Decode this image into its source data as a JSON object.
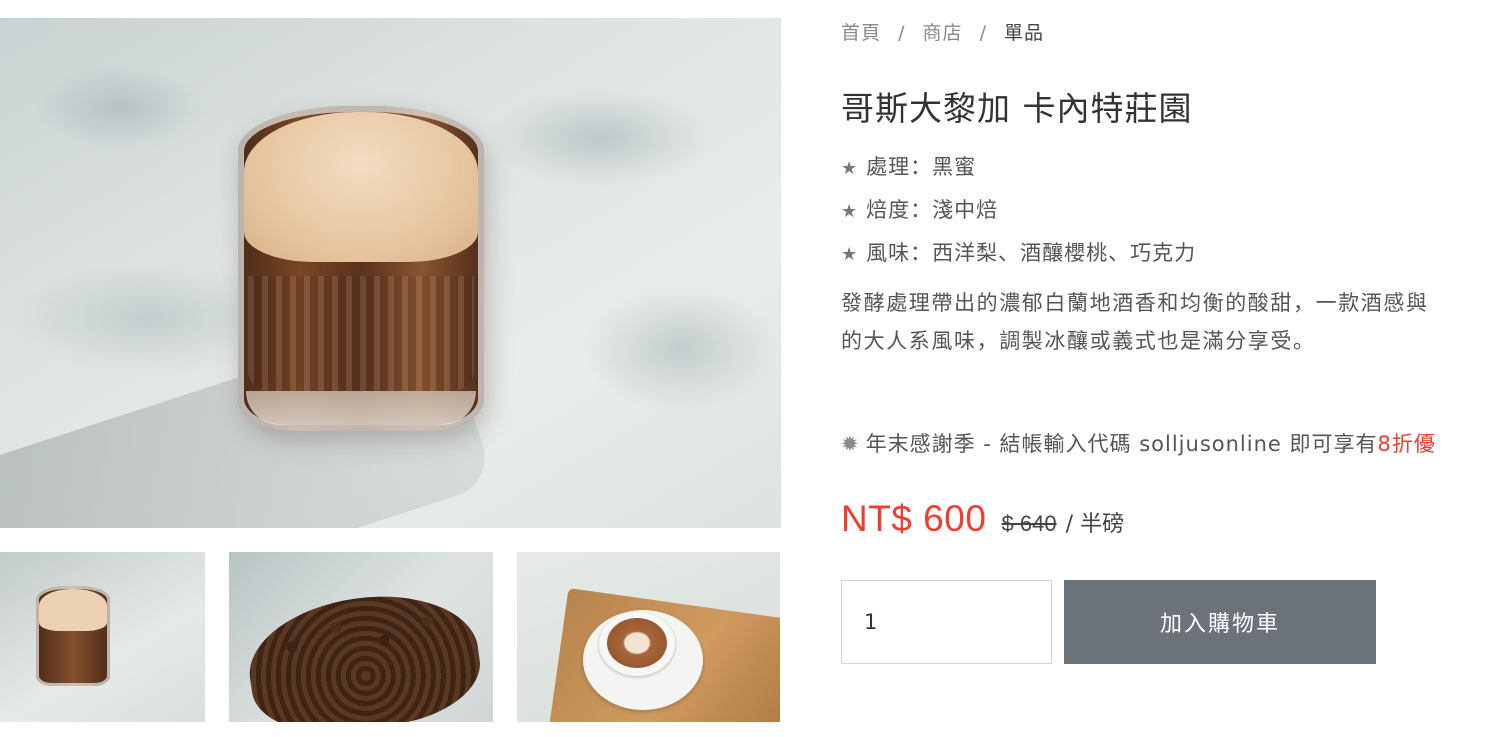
{
  "breadcrumb": {
    "home": "首頁",
    "shop": "商店",
    "current": "單品",
    "separator": "/"
  },
  "product": {
    "title": "哥斯大黎加 卡內特莊園",
    "specs": [
      {
        "icon": "star-icon",
        "text": "處理：黑蜜"
      },
      {
        "icon": "star-icon",
        "text": "焙度：淺中焙"
      },
      {
        "icon": "star-icon",
        "text": "風味：西洋梨、酒釀櫻桃、巧克力"
      }
    ],
    "description_line1": "發酵處理帶出的濃郁白蘭地酒香和均衡的酸甜，一款酒感與",
    "description_line2": "的大人系風味，調製冰釀或義式也是滿分享受。",
    "promo_text": "年末感謝季 - 結帳輸入代碼 solljusonline 即可享有",
    "promo_highlight": "8折優",
    "price": "NT$ 600",
    "original_price": "$ 640",
    "unit": "/ 半磅"
  },
  "cart": {
    "quantity": "1",
    "add_button": "加入購物車"
  },
  "colors": {
    "price_red": "#ef3d2e",
    "button_gray": "#6c727a",
    "text_gray": "#555555"
  }
}
